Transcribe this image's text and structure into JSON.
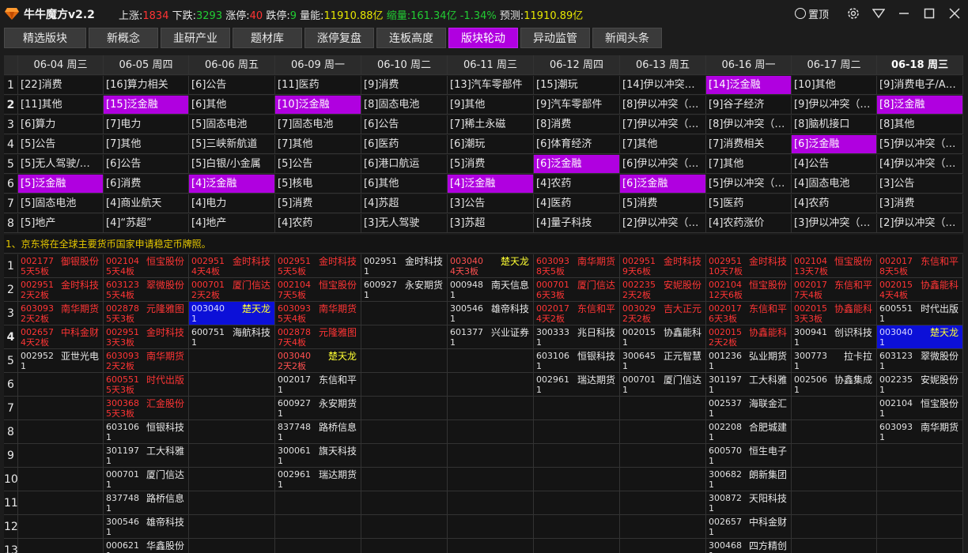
{
  "app": {
    "title": "牛牛魔方v2.2"
  },
  "stats": {
    "up_label": "上涨:",
    "up": "1834",
    "down_label": "下跌:",
    "down": "3293",
    "limit_up_label": "涨停:",
    "limit_up": "40",
    "limit_down_label": "跌停:",
    "limit_down": "9",
    "volume_label": "量能:",
    "volume": "11910.88亿",
    "shrink_label": "缩量:",
    "shrink": "161.34亿",
    "shrink_pct": "-1.34%",
    "forecast_label": "预测:",
    "forecast": "11910.89亿"
  },
  "window": {
    "pin_label": "置顶"
  },
  "colors": {
    "accent": "#b000e0",
    "up": "#ff3333",
    "down": "#22cc33",
    "volume": "#e6e600",
    "highlight_stock": "#0c10d8"
  },
  "tabs": [
    {
      "label": "精选版块",
      "active": false
    },
    {
      "label": "新概念",
      "active": false
    },
    {
      "label": "韭研产业",
      "active": false
    },
    {
      "label": "题材库",
      "active": false
    },
    {
      "label": "涨停复盘",
      "active": false
    },
    {
      "label": "连板高度",
      "active": false
    },
    {
      "label": "版块轮动",
      "active": true
    },
    {
      "label": "异动监管",
      "active": false
    },
    {
      "label": "新闻头条",
      "active": false
    }
  ],
  "rotation": {
    "dates": [
      "06-04 周三",
      "06-05 周四",
      "06-06 周五",
      "06-09 周一",
      "06-10 周二",
      "06-11 周三",
      "06-12 周四",
      "06-13 周五",
      "06-16 周一",
      "06-17 周二",
      "06-18 周三"
    ],
    "rows": [
      [
        {
          "t": "[22]消费"
        },
        {
          "t": "[16]算力相关"
        },
        {
          "t": "[6]公告"
        },
        {
          "t": "[11]医药"
        },
        {
          "t": "[9]消费"
        },
        {
          "t": "[13]汽车零部件"
        },
        {
          "t": "[15]潮玩"
        },
        {
          "t": "[14]伊以冲突…"
        },
        {
          "t": "[14]泛金融",
          "h": true
        },
        {
          "t": "[10]其他"
        },
        {
          "t": "[9]消费电子/A…"
        }
      ],
      [
        {
          "t": "[11]其他"
        },
        {
          "t": "[15]泛金融",
          "h": true
        },
        {
          "t": "[6]其他"
        },
        {
          "t": "[10]泛金融",
          "h": true
        },
        {
          "t": "[8]固态电池"
        },
        {
          "t": "[9]其他"
        },
        {
          "t": "[9]汽车零部件"
        },
        {
          "t": "[8]伊以冲突（…"
        },
        {
          "t": "[9]谷子经济"
        },
        {
          "t": "[9]伊以冲突（…"
        },
        {
          "t": "[8]泛金融",
          "h": true
        }
      ],
      [
        {
          "t": "[6]算力"
        },
        {
          "t": "[7]电力"
        },
        {
          "t": "[5]固态电池"
        },
        {
          "t": "[7]固态电池"
        },
        {
          "t": "[6]公告"
        },
        {
          "t": "[7]稀土永磁"
        },
        {
          "t": "[8]消费"
        },
        {
          "t": "[7]伊以冲突（…"
        },
        {
          "t": "[8]伊以冲突（…"
        },
        {
          "t": "[8]脑机接口"
        },
        {
          "t": "[8]其他"
        }
      ],
      [
        {
          "t": "[5]公告"
        },
        {
          "t": "[7]其他"
        },
        {
          "t": "[5]三峡新航道"
        },
        {
          "t": "[7]其他"
        },
        {
          "t": "[6]医药"
        },
        {
          "t": "[6]潮玩"
        },
        {
          "t": "[6]体育经济"
        },
        {
          "t": "[7]其他"
        },
        {
          "t": "[7]消费相关"
        },
        {
          "t": "[6]泛金融",
          "h": true
        },
        {
          "t": "[5]伊以冲突（…"
        }
      ],
      [
        {
          "t": "[5]无人驾驶/…"
        },
        {
          "t": "[6]公告"
        },
        {
          "t": "[5]白银/小金属"
        },
        {
          "t": "[5]公告"
        },
        {
          "t": "[6]港口航运"
        },
        {
          "t": "[5]消费"
        },
        {
          "t": "[6]泛金融",
          "h": true
        },
        {
          "t": "[6]伊以冲突（…"
        },
        {
          "t": "[7]其他"
        },
        {
          "t": "[4]公告"
        },
        {
          "t": "[4]伊以冲突（…"
        }
      ],
      [
        {
          "t": "[5]泛金融",
          "h": true
        },
        {
          "t": "[6]消费"
        },
        {
          "t": "[4]泛金融",
          "h": true
        },
        {
          "t": "[5]核电"
        },
        {
          "t": "[6]其他"
        },
        {
          "t": "[4]泛金融",
          "h": true
        },
        {
          "t": "[4]农药"
        },
        {
          "t": "[6]泛金融",
          "h": true
        },
        {
          "t": "[5]伊以冲突（…"
        },
        {
          "t": "[4]固态电池"
        },
        {
          "t": "[3]公告"
        }
      ],
      [
        {
          "t": "[5]固态电池"
        },
        {
          "t": "[4]商业航天"
        },
        {
          "t": "[4]电力"
        },
        {
          "t": "[5]消费"
        },
        {
          "t": "[4]苏超"
        },
        {
          "t": "[3]公告"
        },
        {
          "t": "[4]医药"
        },
        {
          "t": "[5]消费"
        },
        {
          "t": "[5]医药"
        },
        {
          "t": "[4]农药"
        },
        {
          "t": "[3]消费"
        }
      ],
      [
        {
          "t": "[5]地产"
        },
        {
          "t": "[4]“苏超”"
        },
        {
          "t": "[4]地产"
        },
        {
          "t": "[4]农药"
        },
        {
          "t": "[3]无人驾驶"
        },
        {
          "t": "[3]苏超"
        },
        {
          "t": "[4]量子科技"
        },
        {
          "t": "[2]伊以冲突（…"
        },
        {
          "t": "[4]农药涨价"
        },
        {
          "t": "[3]伊以冲突（…"
        },
        {
          "t": "[2]伊以冲突（…"
        }
      ]
    ]
  },
  "news": {
    "headline": "1、京东将在全球主要货币国家申请稳定币牌照。"
  },
  "stocks": {
    "columns": [
      [
        {
          "code": "002177",
          "name": "御银股份",
          "boards": "5天5板",
          "up": true
        },
        {
          "code": "002951",
          "name": "金时科技",
          "boards": "2天2板",
          "up": true
        },
        {
          "code": "603093",
          "name": "南华期货",
          "boards": "2天2板",
          "up": true
        },
        {
          "code": "002657",
          "name": "中科金财",
          "boards": "4天2板",
          "up": true
        },
        {
          "code": "002952",
          "name": "亚世光电",
          "boards": "1",
          "up": false
        }
      ],
      [
        {
          "code": "002104",
          "name": "恒宝股份",
          "boards": "5天4板",
          "up": true
        },
        {
          "code": "603123",
          "name": "翠微股份",
          "boards": "5天4板",
          "up": true
        },
        {
          "code": "002878",
          "name": "元隆雅图",
          "boards": "5天3板",
          "up": true
        },
        {
          "code": "002951",
          "name": "金时科技",
          "boards": "3天3板",
          "up": true
        },
        {
          "code": "603093",
          "name": "南华期货",
          "boards": "2天2板",
          "up": true
        },
        {
          "code": "600551",
          "name": "时代出版",
          "boards": "5天3板",
          "up": true
        },
        {
          "code": "300368",
          "name": "汇金股份",
          "boards": "5天3板",
          "up": true
        },
        {
          "code": "603106",
          "name": "恒银科技",
          "boards": "1",
          "up": false
        },
        {
          "code": "301197",
          "name": "工大科雅",
          "boards": "1",
          "up": false
        },
        {
          "code": "000701",
          "name": "厦门信达",
          "boards": "1",
          "up": false
        },
        {
          "code": "837748",
          "name": "路桥信息",
          "boards": "1",
          "up": false
        },
        {
          "code": "300546",
          "name": "雄帝科技",
          "boards": "1",
          "up": false
        },
        {
          "code": "000621",
          "name": "华鑫股份",
          "boards": "1",
          "up": false
        }
      ],
      [
        {
          "code": "002951",
          "name": "金时科技",
          "boards": "4天4板",
          "up": true
        },
        {
          "code": "000701",
          "name": "厦门信达",
          "boards": "2天2板",
          "up": true
        },
        {
          "code": "003040",
          "name": "楚天龙",
          "boards": "1",
          "up": false,
          "blue": true
        },
        {
          "code": "600751",
          "name": "海航科技",
          "boards": "1",
          "up": false
        }
      ],
      [
        {
          "code": "002951",
          "name": "金时科技",
          "boards": "5天5板",
          "up": true
        },
        {
          "code": "002104",
          "name": "恒宝股份",
          "boards": "7天5板",
          "up": true
        },
        {
          "code": "603093",
          "name": "南华期货",
          "boards": "5天4板",
          "up": true
        },
        {
          "code": "002878",
          "name": "元隆雅图",
          "boards": "7天4板",
          "up": true
        },
        {
          "code": "003040",
          "name": "楚天龙",
          "boards": "2天2板",
          "up": true,
          "blue": true
        },
        {
          "code": "002017",
          "name": "东信和平",
          "boards": "1",
          "up": false
        },
        {
          "code": "600927",
          "name": "永安期货",
          "boards": "1",
          "up": false
        },
        {
          "code": "837748",
          "name": "路桥信息",
          "boards": "1",
          "up": false
        },
        {
          "code": "300061",
          "name": "旗天科技",
          "boards": "1",
          "up": false
        },
        {
          "code": "002961",
          "name": "瑞达期货",
          "boards": "1",
          "up": false
        }
      ],
      [
        {
          "code": "002951",
          "name": "金时科技",
          "boards": "1",
          "up": false
        },
        {
          "code": "600927",
          "name": "永安期货",
          "boards": "1",
          "up": false
        }
      ],
      [
        {
          "code": "003040",
          "name": "楚天龙",
          "boards": "4天3板",
          "up": true,
          "blue": true
        },
        {
          "code": "000948",
          "name": "南天信息",
          "boards": "1",
          "up": false
        },
        {
          "code": "300546",
          "name": "雄帝科技",
          "boards": "1",
          "up": false
        },
        {
          "code": "601377",
          "name": "兴业证券",
          "boards": "1",
          "up": false
        }
      ],
      [
        {
          "code": "603093",
          "name": "南华期货",
          "boards": "8天5板",
          "up": true
        },
        {
          "code": "000701",
          "name": "厦门信达",
          "boards": "6天3板",
          "up": true
        },
        {
          "code": "002017",
          "name": "东信和平",
          "boards": "4天2板",
          "up": true
        },
        {
          "code": "300333",
          "name": "兆日科技",
          "boards": "1",
          "up": false
        },
        {
          "code": "603106",
          "name": "恒银科技",
          "boards": "1",
          "up": false
        },
        {
          "code": "002961",
          "name": "瑞达期货",
          "boards": "1",
          "up": false
        }
      ],
      [
        {
          "code": "002951",
          "name": "金时科技",
          "boards": "9天6板",
          "up": true
        },
        {
          "code": "002235",
          "name": "安妮股份",
          "boards": "2天2板",
          "up": true
        },
        {
          "code": "003029",
          "name": "吉大正元",
          "boards": "2天2板",
          "up": true
        },
        {
          "code": "002015",
          "name": "协鑫能科",
          "boards": "1",
          "up": false
        },
        {
          "code": "300645",
          "name": "正元智慧",
          "boards": "1",
          "up": false
        },
        {
          "code": "000701",
          "name": "厦门信达",
          "boards": "1",
          "up": false
        }
      ],
      [
        {
          "code": "002951",
          "name": "金时科技",
          "boards": "10天7板",
          "up": true
        },
        {
          "code": "002104",
          "name": "恒宝股份",
          "boards": "12天6板",
          "up": true
        },
        {
          "code": "002017",
          "name": "东信和平",
          "boards": "6天3板",
          "up": true
        },
        {
          "code": "002015",
          "name": "协鑫能科",
          "boards": "2天2板",
          "up": true
        },
        {
          "code": "001236",
          "name": "弘业期货",
          "boards": "1",
          "up": false
        },
        {
          "code": "301197",
          "name": "工大科雅",
          "boards": "1",
          "up": false
        },
        {
          "code": "002537",
          "name": "海联金汇",
          "boards": "1",
          "up": false
        },
        {
          "code": "002208",
          "name": "合肥城建",
          "boards": "1",
          "up": false
        },
        {
          "code": "600570",
          "name": "恒生电子",
          "boards": "1",
          "up": false
        },
        {
          "code": "300682",
          "name": "朗新集团",
          "boards": "1",
          "up": false
        },
        {
          "code": "300872",
          "name": "天阳科技",
          "boards": "1",
          "up": false
        },
        {
          "code": "002657",
          "name": "中科金财",
          "boards": "1",
          "up": false
        },
        {
          "code": "300468",
          "name": "四方精创",
          "boards": "1",
          "up": false
        }
      ],
      [
        {
          "code": "002104",
          "name": "恒宝股份",
          "boards": "13天7板",
          "up": true
        },
        {
          "code": "002017",
          "name": "东信和平",
          "boards": "7天4板",
          "up": true
        },
        {
          "code": "002015",
          "name": "协鑫能科",
          "boards": "3天3板",
          "up": true
        },
        {
          "code": "300941",
          "name": "创识科技",
          "boards": "1",
          "up": false
        },
        {
          "code": "300773",
          "name": "拉卡拉",
          "boards": "1",
          "up": false
        },
        {
          "code": "002506",
          "name": "协鑫集成",
          "boards": "1",
          "up": false
        }
      ],
      [
        {
          "code": "002017",
          "name": "东信和平",
          "boards": "8天5板",
          "up": true
        },
        {
          "code": "002015",
          "name": "协鑫能科",
          "boards": "4天4板",
          "up": true
        },
        {
          "code": "600551",
          "name": "时代出版",
          "boards": "1",
          "up": false
        },
        {
          "code": "003040",
          "name": "楚天龙",
          "boards": "1",
          "up": false,
          "blue": true
        },
        {
          "code": "603123",
          "name": "翠微股份",
          "boards": "1",
          "up": false
        },
        {
          "code": "002235",
          "name": "安妮股份",
          "boards": "1",
          "up": false
        },
        {
          "code": "002104",
          "name": "恒宝股份",
          "boards": "1",
          "up": false
        },
        {
          "code": "603093",
          "name": "南华期货",
          "boards": "1",
          "up": false
        }
      ]
    ]
  }
}
